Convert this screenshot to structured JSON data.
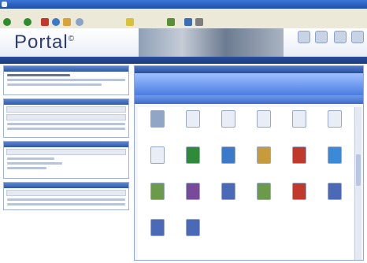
{
  "colors": {
    "accent": "#2f58a8",
    "nav": "#1b3a7c",
    "folder_header": "#4a7ce0",
    "logo": "#2f3d6e"
  },
  "logo": {
    "text": "Portal",
    "mark": "©"
  },
  "file_grid": {
    "icons": [
      "image-thumbnail-icon",
      "text-document-icon",
      "text-document-icon",
      "text-document-icon",
      "text-document-icon",
      "text-document-icon",
      "text-document-icon",
      "excel-icon",
      "html-icon",
      "archive-icon",
      "pdf-icon",
      "web-icon",
      "image-icon",
      "video-icon",
      "document-icon",
      "image-icon",
      "pdf-icon",
      "document-icon",
      "document-icon",
      "document-icon"
    ]
  }
}
